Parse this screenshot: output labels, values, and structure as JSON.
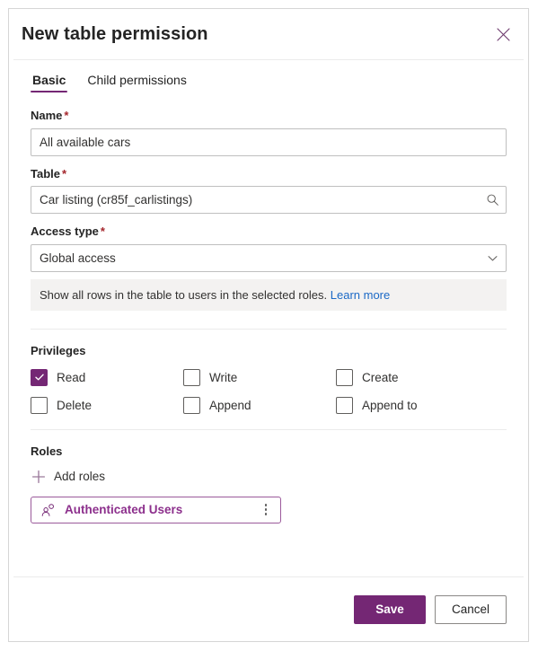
{
  "dialog": {
    "title": "New table permission",
    "close_icon": "close-icon"
  },
  "tabs": [
    {
      "label": "Basic",
      "active": true
    },
    {
      "label": "Child permissions",
      "active": false
    }
  ],
  "form": {
    "name": {
      "label": "Name",
      "required_marker": "*",
      "value": "All available cars",
      "placeholder": ""
    },
    "table": {
      "label": "Table",
      "required_marker": "*",
      "value": "Car listing (cr85f_carlistings)",
      "placeholder": "",
      "icon": "search-icon"
    },
    "access_type": {
      "label": "Access type",
      "required_marker": "*",
      "value": "Global access",
      "icon": "chevron-down-icon",
      "options": [
        "Global access"
      ]
    },
    "info": {
      "text": "Show all rows in the table to users in the selected roles.",
      "link_label": "Learn more"
    }
  },
  "privileges": {
    "title": "Privileges",
    "items": [
      {
        "label": "Read",
        "checked": true
      },
      {
        "label": "Write",
        "checked": false
      },
      {
        "label": "Create",
        "checked": false
      },
      {
        "label": "Delete",
        "checked": false
      },
      {
        "label": "Append",
        "checked": false
      },
      {
        "label": "Append to",
        "checked": false
      }
    ]
  },
  "roles": {
    "title": "Roles",
    "add_label": "Add roles",
    "add_icon": "plus-icon",
    "chips": [
      {
        "label": "Authenticated Users",
        "icon": "person-icon",
        "more_icon": "more-vertical-icon"
      }
    ]
  },
  "footer": {
    "save_label": "Save",
    "cancel_label": "Cancel"
  },
  "colors": {
    "accent": "#742774",
    "chip_text": "#8c2f8c",
    "required": "#a4262c",
    "link": "#1b69c6",
    "banner_bg": "#f3f2f1"
  }
}
